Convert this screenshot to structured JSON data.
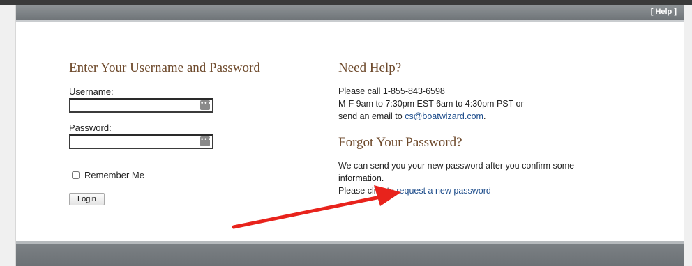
{
  "header": {
    "help_label": "[ Help ]"
  },
  "login": {
    "title": "Enter Your Username and Password",
    "username_label": "Username:",
    "username_value": "",
    "password_label": "Password:",
    "password_value": "",
    "remember_label": "Remember Me",
    "login_button": "Login"
  },
  "help": {
    "title": "Need Help?",
    "line1": "Please call 1-855-843-6598",
    "line2": "M-F 9am to 7:30pm EST 6am to 4:30pm PST or",
    "line3_prefix": "send an email to ",
    "email": "cs@boatwizard.com",
    "line3_suffix": "."
  },
  "forgot": {
    "title": "Forgot Your Password?",
    "line1": "We can send you your new password after you confirm some information.",
    "line2_prefix": "Please click to ",
    "link_label": "request a new password"
  },
  "annotation": {
    "arrow_color": "#e8231c"
  },
  "colors": {
    "heading": "#6e4a2c",
    "link": "#1f4e8c",
    "bar": "#7b8084"
  }
}
